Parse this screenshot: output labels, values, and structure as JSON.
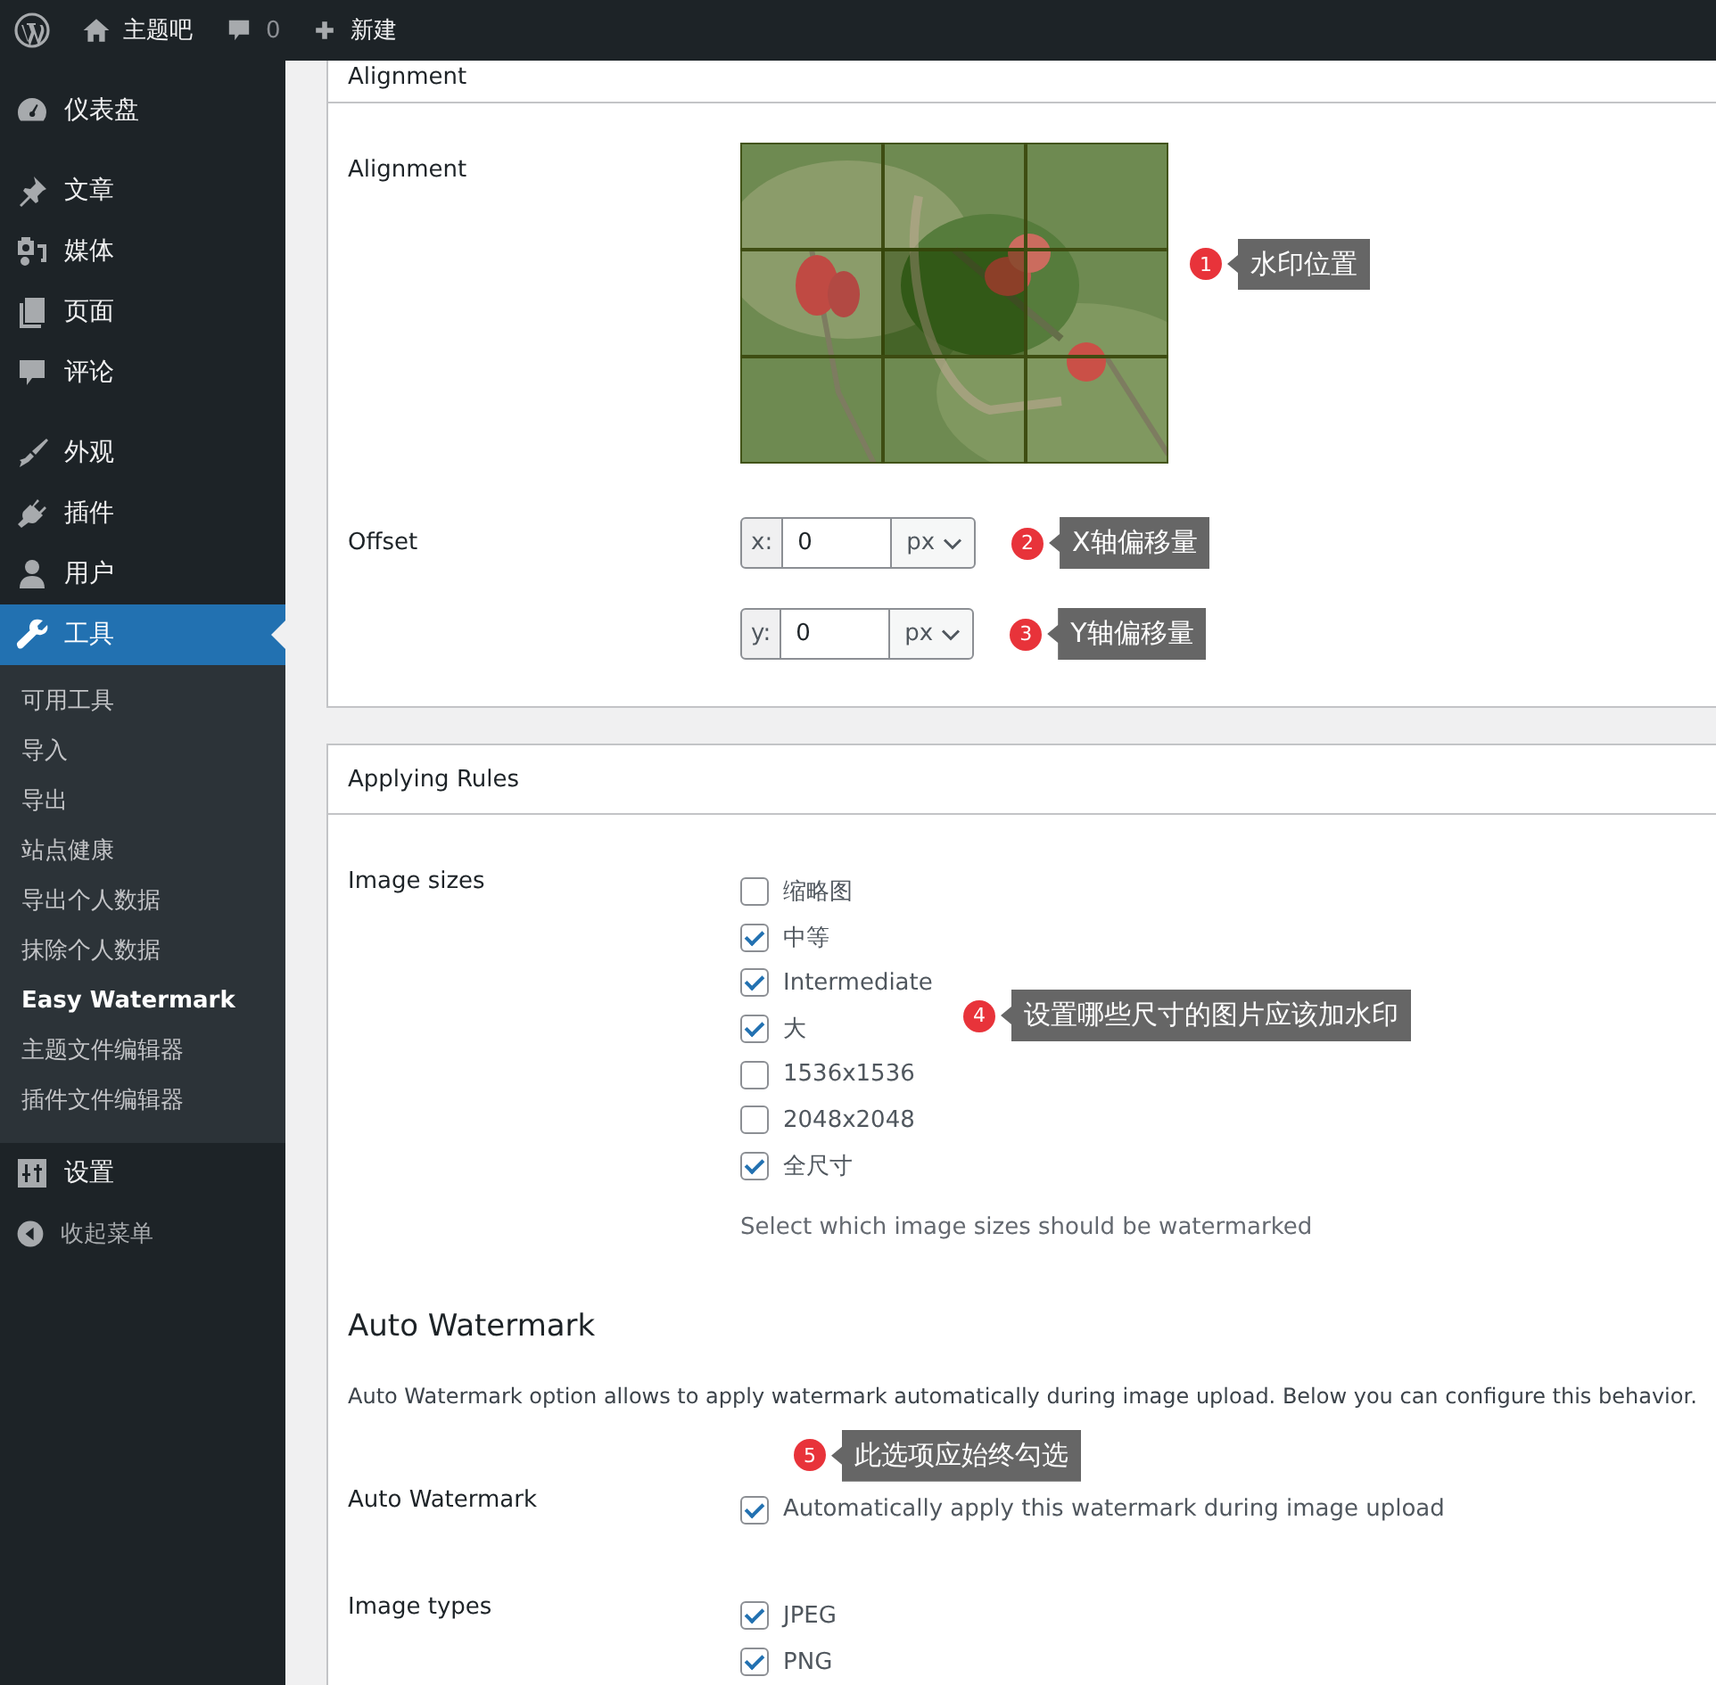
{
  "admin_bar": {
    "site_name": "主题吧",
    "comment_count": "0",
    "new_label": "新建"
  },
  "sidebar": {
    "groups": [
      [
        {
          "label": "仪表盘",
          "selected": false
        }
      ],
      [
        {
          "label": "文章",
          "selected": false
        },
        {
          "label": "媒体",
          "selected": false
        },
        {
          "label": "页面",
          "selected": false
        },
        {
          "label": "评论",
          "selected": false
        }
      ],
      [
        {
          "label": "外观",
          "selected": false
        },
        {
          "label": "插件",
          "selected": false
        },
        {
          "label": "用户",
          "selected": false
        },
        {
          "label": "工具",
          "selected": true,
          "expanded": true,
          "children": [
            {
              "label": "可用工具",
              "selected": false
            },
            {
              "label": "导入",
              "selected": false
            },
            {
              "label": "导出",
              "selected": false
            },
            {
              "label": "站点健康",
              "selected": false
            },
            {
              "label": "导出个人数据",
              "selected": false
            },
            {
              "label": "抹除个人数据",
              "selected": false
            },
            {
              "label": "Easy Watermark",
              "selected": true
            },
            {
              "label": "主题文件编辑器",
              "selected": false
            },
            {
              "label": "插件文件编辑器",
              "selected": false
            }
          ]
        },
        {
          "label": "设置",
          "selected": false
        }
      ]
    ],
    "collapse": "收起菜单"
  },
  "panels": [
    {
      "title": "Alignment",
      "rows": [
        {
          "kind": "alignment",
          "label": "Alignment",
          "cells": [
            {
              "selected": false
            },
            {
              "selected": false
            },
            {
              "selected": false
            },
            {
              "selected": false
            },
            {
              "selected": true
            },
            {
              "selected": false
            },
            {
              "selected": false
            },
            {
              "selected": false
            },
            {
              "selected": false
            }
          ],
          "callout": {
            "number": "1",
            "text": "水印位置"
          }
        },
        {
          "kind": "offset",
          "label": "Offset",
          "fields": [
            {
              "axis": "x:",
              "value": "0",
              "unit": "px",
              "callout": {
                "number": "2",
                "text": "X轴偏移量"
              }
            },
            {
              "axis": "y:",
              "value": "0",
              "unit": "px",
              "callout": {
                "number": "3",
                "text": "Y轴偏移量"
              }
            }
          ]
        }
      ]
    },
    {
      "title": "Applying Rules",
      "rows": [
        {
          "kind": "checklist",
          "label": "Image sizes",
          "options": [
            {
              "label": "缩略图",
              "checked": false
            },
            {
              "label": "中等",
              "checked": true
            },
            {
              "label": "Intermediate",
              "checked": true
            },
            {
              "label": "大",
              "checked": true
            },
            {
              "label": "1536x1536",
              "checked": false
            },
            {
              "label": "2048x2048",
              "checked": false
            },
            {
              "label": "全尺寸",
              "checked": true
            }
          ],
          "help": "Select which image sizes should be watermarked",
          "callout": {
            "number": "4",
            "text": "设置哪些尺寸的图片应该加水印"
          }
        },
        {
          "kind": "heading",
          "text": "Auto Watermark"
        },
        {
          "kind": "paragraph",
          "text": "Auto Watermark option allows to apply watermark automatically during image upload. Below you can configure this behavior."
        },
        {
          "kind": "checklist",
          "label": "Auto Watermark",
          "options": [
            {
              "label": "Automatically apply this watermark during image upload",
              "checked": true
            }
          ],
          "callout": {
            "number": "5",
            "text": "此选项应始终勾选"
          }
        },
        {
          "kind": "checklist",
          "label": "Image types",
          "options": [
            {
              "label": "JPEG",
              "checked": true
            },
            {
              "label": "PNG",
              "checked": true
            }
          ]
        }
      ]
    }
  ]
}
